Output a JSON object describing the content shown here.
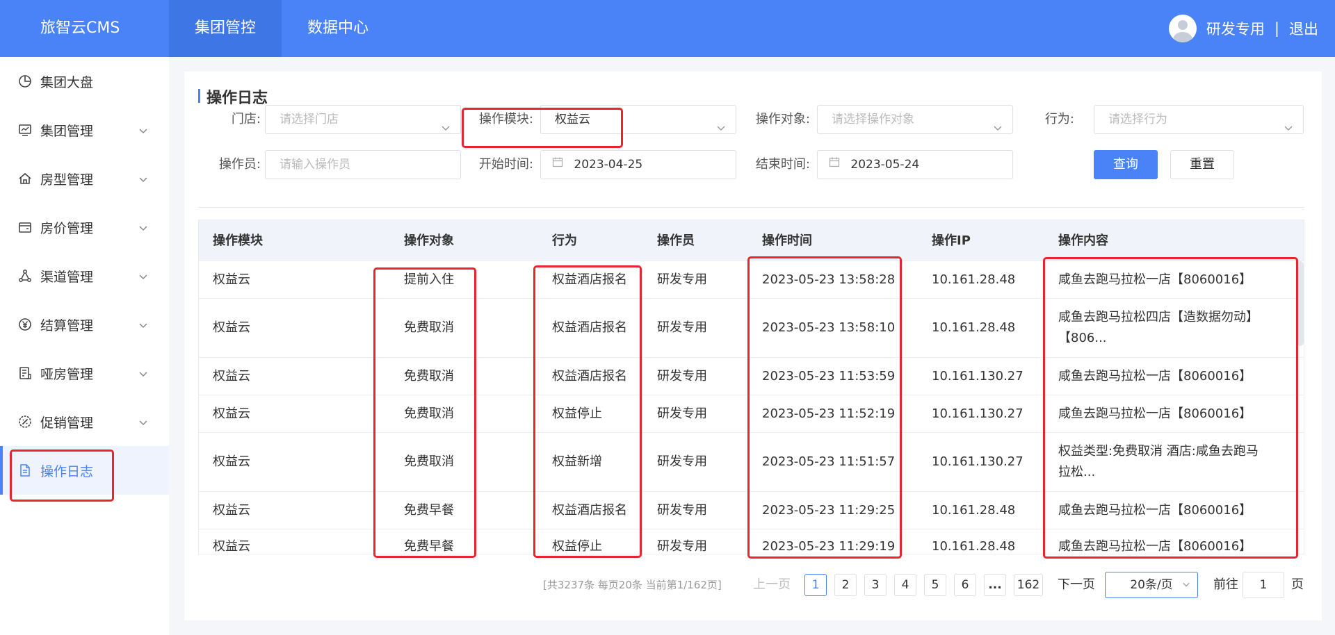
{
  "header": {
    "brand": "旅智云CMS",
    "nav": [
      "集团管控",
      "数据中心"
    ],
    "user": "研发专用",
    "separator": "|",
    "logout": "退出"
  },
  "sidebar": {
    "items": [
      {
        "label": "集团大盘",
        "icon": "dashboard-icon"
      },
      {
        "label": "集团管理",
        "icon": "monitor-icon"
      },
      {
        "label": "房型管理",
        "icon": "home-icon"
      },
      {
        "label": "房价管理",
        "icon": "wallet-icon"
      },
      {
        "label": "渠道管理",
        "icon": "share-icon"
      },
      {
        "label": "结算管理",
        "icon": "yen-icon"
      },
      {
        "label": "哑房管理",
        "icon": "list-icon"
      },
      {
        "label": "促销管理",
        "icon": "tag-icon"
      },
      {
        "label": "操作日志",
        "icon": "document-icon"
      }
    ]
  },
  "page": {
    "title": "操作日志"
  },
  "filters": {
    "store_label": "门店:",
    "store_placeholder": "请选择门店",
    "module_label": "操作模块:",
    "module_value": "权益云",
    "target_label": "操作对象:",
    "target_placeholder": "请选择操作对象",
    "action_label": "行为:",
    "action_placeholder": "请选择行为",
    "operator_label": "操作员:",
    "operator_placeholder": "请输入操作员",
    "start_label": "开始时间:",
    "start_value": "2023-04-25",
    "end_label": "结束时间:",
    "end_value": "2023-05-24",
    "query_button": "查询",
    "reset_button": "重置"
  },
  "table": {
    "columns": [
      "操作模块",
      "操作对象",
      "行为",
      "操作员",
      "操作时间",
      "操作IP",
      "操作内容"
    ],
    "rows": [
      {
        "module": "权益云",
        "target": "提前入住",
        "action": "权益酒店报名",
        "operator": "研发专用",
        "time": "2023-05-23 13:58:28",
        "ip": "10.161.28.48",
        "content1": "咸鱼去跑马拉松一店【8060016】",
        "content2": ""
      },
      {
        "module": "权益云",
        "target": "免费取消",
        "action": "权益酒店报名",
        "operator": "研发专用",
        "time": "2023-05-23 13:58:10",
        "ip": "10.161.28.48",
        "content1": "咸鱼去跑马拉松四店【造数据勿动】",
        "content2": "【806..."
      },
      {
        "module": "权益云",
        "target": "免费取消",
        "action": "权益酒店报名",
        "operator": "研发专用",
        "time": "2023-05-23 11:53:59",
        "ip": "10.161.130.27",
        "content1": "咸鱼去跑马拉松一店【8060016】",
        "content2": ""
      },
      {
        "module": "权益云",
        "target": "免费取消",
        "action": "权益停止",
        "operator": "研发专用",
        "time": "2023-05-23 11:52:19",
        "ip": "10.161.130.27",
        "content1": "咸鱼去跑马拉松一店【8060016】",
        "content2": ""
      },
      {
        "module": "权益云",
        "target": "免费取消",
        "action": "权益新增",
        "operator": "研发专用",
        "time": "2023-05-23 11:51:57",
        "ip": "10.161.130.27",
        "content1": "权益类型:免费取消 酒店:咸鱼去跑马",
        "content2": "拉松..."
      },
      {
        "module": "权益云",
        "target": "免费早餐",
        "action": "权益酒店报名",
        "operator": "研发专用",
        "time": "2023-05-23 11:29:25",
        "ip": "10.161.28.48",
        "content1": "咸鱼去跑马拉松一店【8060016】",
        "content2": ""
      },
      {
        "module": "权益云",
        "target": "免费早餐",
        "action": "权益停止",
        "operator": "研发专用",
        "time": "2023-05-23 11:29:19",
        "ip": "10.161.28.48",
        "content1": "咸鱼去跑马拉松一店【8060016】",
        "content2": ""
      }
    ]
  },
  "pagination": {
    "summary": "[共3237条 每页20条 当前第1/162页]",
    "prev": "上一页",
    "pages": [
      "1",
      "2",
      "3",
      "4",
      "5",
      "6",
      "...",
      "162"
    ],
    "next": "下一页",
    "page_size": "20条/页",
    "goto_label": "前往",
    "goto_value": "1",
    "page_unit": "页"
  },
  "colors": {
    "primary": "#4a82f7",
    "highlight": "#e8242f"
  }
}
